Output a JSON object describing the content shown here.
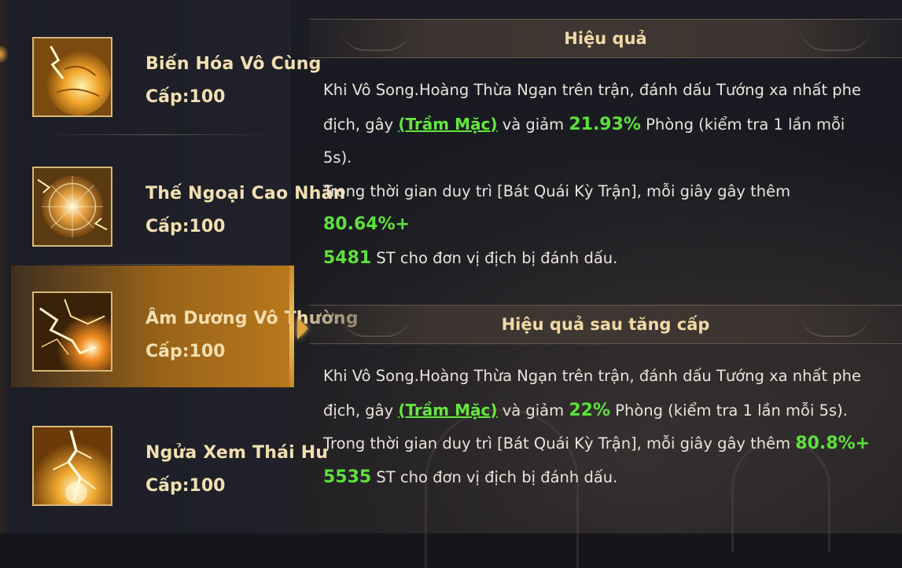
{
  "skills": [
    {
      "name": "Biến Hóa Vô Cùng",
      "level": "Cấp:100",
      "icon": "golden-orb-icon"
    },
    {
      "name": "Thế Ngoại Cao Nhân",
      "level": "Cấp:100",
      "icon": "radiant-sphere-icon"
    },
    {
      "name": "Âm Dương Vô Thường",
      "level": "Cấp:100",
      "icon": "lightning-crack-icon",
      "selected": true
    },
    {
      "name": "Ngửa Xem Thái Hư",
      "level": "Cấp:100",
      "icon": "lightning-strike-icon"
    }
  ],
  "effect": {
    "title": "Hiệu quả",
    "t1": "Khi Vô Song.Hoàng Thừa Ngạn trên trận, đánh dấu Tướng xa nhất phe",
    "t2": "địch, gây ",
    "tag": "(Trầm Mặc)",
    "t3": " và giảm ",
    "pct": "21.93%",
    "t4": " Phòng (kiểm tra 1 lần mỗi 5s).",
    "t5": "Trong thời gian duy trì [Bát Quái Kỳ Trận], mỗi giây gây thêm ",
    "dmg_pct": "80.64%+",
    "dmg_flat": "5481",
    "t6": " ST cho đơn vị địch bị đánh dấu."
  },
  "upgrade": {
    "title": "Hiệu quả sau tăng cấp",
    "t1": "Khi Vô Song.Hoàng Thừa Ngạn trên trận, đánh dấu Tướng xa nhất phe",
    "t2": "địch, gây ",
    "tag": "(Trầm Mặc)",
    "t3": " và giảm ",
    "pct": "22%",
    "t4": " Phòng (kiểm tra 1 lần mỗi 5s).",
    "t5": "Trong thời gian duy trì [Bát Quái Kỳ Trận], mỗi giây gây thêm ",
    "dmg_pct": "80.8%+",
    "dmg_flat": "5535",
    "t6": " ST cho đơn vị địch bị đánh dấu."
  },
  "colors": {
    "highlight": "#5ee03c",
    "title": "#f1d9a6",
    "selected": "#b8781c"
  }
}
